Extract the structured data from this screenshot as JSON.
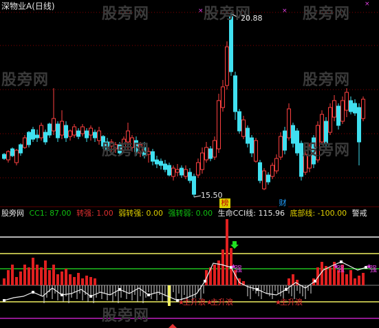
{
  "title": "深物业A(日线)",
  "high_price_label": "20.88",
  "low_price_label": "15.50",
  "badges": {
    "bang": "榜",
    "cai": "财"
  },
  "watermark": "股旁网",
  "indicator_name": "股旁网",
  "indicators": [
    {
      "label": "CC1: 87.00",
      "color": "#10c010"
    },
    {
      "label": "转强: 1.00",
      "color": "#e03030"
    },
    {
      "label": "弱转强: 0.00",
      "color": "#e0d000"
    },
    {
      "label": "强转弱: 0.00",
      "color": "#10c010"
    },
    {
      "label": "生命CCI线: 115.96",
      "color": "#e8e8e8"
    },
    {
      "label": "底部线: -100.00",
      "color": "#e0d000"
    },
    {
      "label": "警戒",
      "color": "#e8e8e8"
    }
  ],
  "signal_tags": {
    "strong": "强",
    "rise": "主升浪"
  },
  "colors": {
    "up": "#ff4040",
    "down": "#40e0f0",
    "grid": "#8b0000",
    "bar_red": "#e02020",
    "line_white": "#f0f0f0",
    "line_yellow": "#f0f060",
    "line_green": "#20c020",
    "line_magenta": "#c020c0"
  }
}
